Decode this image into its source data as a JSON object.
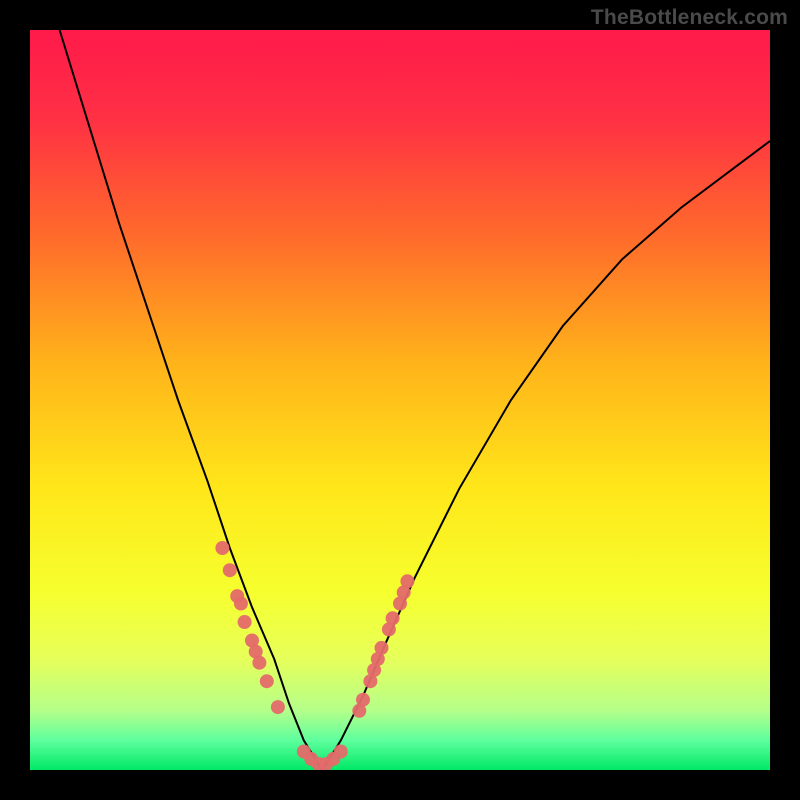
{
  "watermark": "TheBottleneck.com",
  "gradient": {
    "stops": [
      {
        "offset": 0,
        "color": "#ff1a4a"
      },
      {
        "offset": 0.12,
        "color": "#ff3044"
      },
      {
        "offset": 0.28,
        "color": "#ff6b2b"
      },
      {
        "offset": 0.45,
        "color": "#ffb31a"
      },
      {
        "offset": 0.62,
        "color": "#ffe71a"
      },
      {
        "offset": 0.76,
        "color": "#f6ff2e"
      },
      {
        "offset": 0.85,
        "color": "#e6ff5a"
      },
      {
        "offset": 0.92,
        "color": "#b4ff8a"
      },
      {
        "offset": 0.96,
        "color": "#5eff9e"
      },
      {
        "offset": 1.0,
        "color": "#00e865"
      }
    ]
  },
  "chart_data": {
    "type": "line",
    "title": "",
    "xlabel": "",
    "ylabel": "",
    "xlim": [
      0,
      1
    ],
    "ylim": [
      0,
      1
    ],
    "series": [
      {
        "name": "bottleneck-curve",
        "color": "#000000",
        "x": [
          0.04,
          0.08,
          0.12,
          0.16,
          0.2,
          0.24,
          0.27,
          0.3,
          0.33,
          0.35,
          0.37,
          0.395,
          0.42,
          0.45,
          0.48,
          0.52,
          0.58,
          0.65,
          0.72,
          0.8,
          0.88,
          0.96,
          1.0
        ],
        "values": [
          1.0,
          0.87,
          0.74,
          0.62,
          0.5,
          0.39,
          0.3,
          0.22,
          0.15,
          0.09,
          0.04,
          0.0,
          0.04,
          0.1,
          0.17,
          0.26,
          0.38,
          0.5,
          0.6,
          0.69,
          0.76,
          0.82,
          0.85
        ]
      }
    ],
    "markers": [
      {
        "name": "left-cluster",
        "color": "#e46a6a",
        "x": [
          0.26,
          0.27,
          0.28,
          0.285,
          0.29,
          0.3,
          0.305,
          0.31,
          0.32,
          0.335
        ],
        "values": [
          0.3,
          0.27,
          0.235,
          0.225,
          0.2,
          0.175,
          0.16,
          0.145,
          0.12,
          0.085
        ]
      },
      {
        "name": "valley-cluster",
        "color": "#e46a6a",
        "x": [
          0.37,
          0.38,
          0.39,
          0.4,
          0.41,
          0.42
        ],
        "values": [
          0.025,
          0.015,
          0.008,
          0.008,
          0.015,
          0.025
        ]
      },
      {
        "name": "right-cluster",
        "color": "#e46a6a",
        "x": [
          0.445,
          0.45,
          0.46,
          0.465,
          0.47,
          0.475,
          0.485,
          0.49,
          0.5,
          0.505,
          0.51
        ],
        "values": [
          0.08,
          0.095,
          0.12,
          0.135,
          0.15,
          0.165,
          0.19,
          0.205,
          0.225,
          0.24,
          0.255
        ]
      }
    ]
  }
}
